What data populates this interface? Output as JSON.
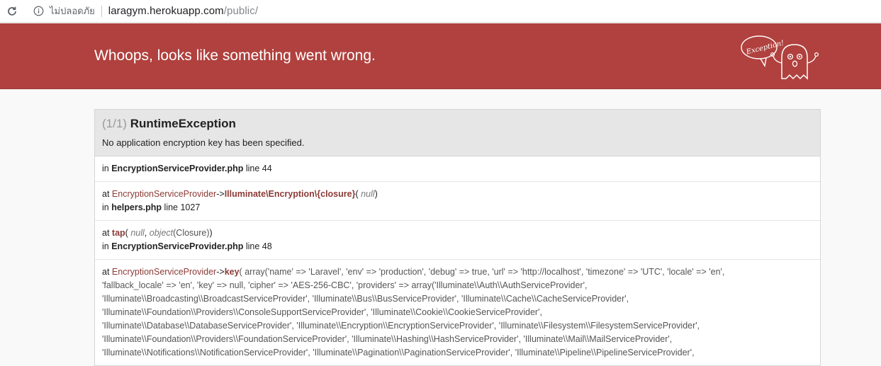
{
  "browser": {
    "security_label": "ไม่ปลอดภัย",
    "url_host": "laragym.herokuapp.com",
    "url_path": "/public/"
  },
  "banner": {
    "title": "Whoops, looks like something went wrong.",
    "logo_text": "Exception!",
    "color": "#b0413e"
  },
  "exception": {
    "count": "(1/1)",
    "name": "RuntimeException",
    "message": "No application encryption key has been specified."
  },
  "trace": {
    "t0": {
      "in_label": "in",
      "file": "EncryptionServiceProvider.php",
      "line_label": "line 44"
    },
    "t1": {
      "at_label": "at",
      "class": "EncryptionServiceProvider",
      "arrow": "->",
      "method": "Illuminate\\Encryption\\{closure}",
      "open": "(",
      "args": "null",
      "close": ")",
      "in_label": "in",
      "file": "helpers.php",
      "line_label": "line 1027"
    },
    "t2": {
      "at_label": "at",
      "method": "tap",
      "open": "(",
      "arg1": "null",
      "sep": ",",
      "arg2": "object",
      "arg2_val": "(Closure)",
      "close": ")",
      "in_label": "in",
      "file": "EncryptionServiceProvider.php",
      "line_label": "line 48"
    },
    "t3": {
      "at_label": "at",
      "class": "EncryptionServiceProvider",
      "arrow": "->",
      "method": "key",
      "lines": [
        "array('name' => 'Laravel', 'env' => 'production', 'debug' => true, 'url' => 'http://localhost', 'timezone' => 'UTC', 'locale' => 'en',",
        "'fallback_locale' => 'en', 'key' => null, 'cipher' => 'AES-256-CBC', 'providers' => array('Illuminate\\\\Auth\\\\AuthServiceProvider',",
        "'Illuminate\\\\Broadcasting\\\\BroadcastServiceProvider', 'Illuminate\\\\Bus\\\\BusServiceProvider', 'Illuminate\\\\Cache\\\\CacheServiceProvider',",
        "'Illuminate\\\\Foundation\\\\Providers\\\\ConsoleSupportServiceProvider', 'Illuminate\\\\Cookie\\\\CookieServiceProvider',",
        "'Illuminate\\\\Database\\\\DatabaseServiceProvider', 'Illuminate\\\\Encryption\\\\EncryptionServiceProvider', 'Illuminate\\\\Filesystem\\\\FilesystemServiceProvider',",
        "'Illuminate\\\\Foundation\\\\Providers\\\\FoundationServiceProvider', 'Illuminate\\\\Hashing\\\\HashServiceProvider', 'Illuminate\\\\Mail\\\\MailServiceProvider',",
        "'Illuminate\\\\Notifications\\\\NotificationServiceProvider', 'Illuminate\\\\Pagination\\\\PaginationServiceProvider', 'Illuminate\\\\Pipeline\\\\PipelineServiceProvider',"
      ]
    }
  }
}
